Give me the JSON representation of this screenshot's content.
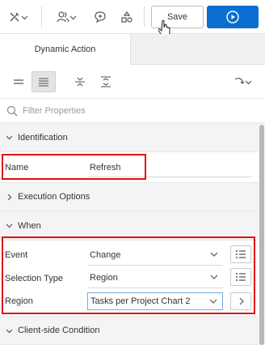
{
  "toolbar": {
    "save_label": "Save",
    "icons": [
      "tools-icon",
      "chevron-down-icon",
      "users-icon",
      "chevron-down-icon",
      "comment-add-icon",
      "shared-components-icon",
      "play-icon"
    ]
  },
  "tabs": {
    "active": "Dynamic Action"
  },
  "filter": {
    "placeholder": "Filter Properties"
  },
  "groups": {
    "identification": "Identification",
    "execution": "Execution Options",
    "when": "When",
    "client": "Client-side Condition"
  },
  "identification": {
    "name_label": "Name",
    "name_value": "Refresh"
  },
  "when": {
    "event_label": "Event",
    "event_value": "Change",
    "selection_type_label": "Selection Type",
    "selection_type_value": "Region",
    "region_label": "Region",
    "region_value": "Tasks per Project Chart 2"
  },
  "colors": {
    "accent": "#0a6ed1",
    "highlight": "#e01010"
  }
}
